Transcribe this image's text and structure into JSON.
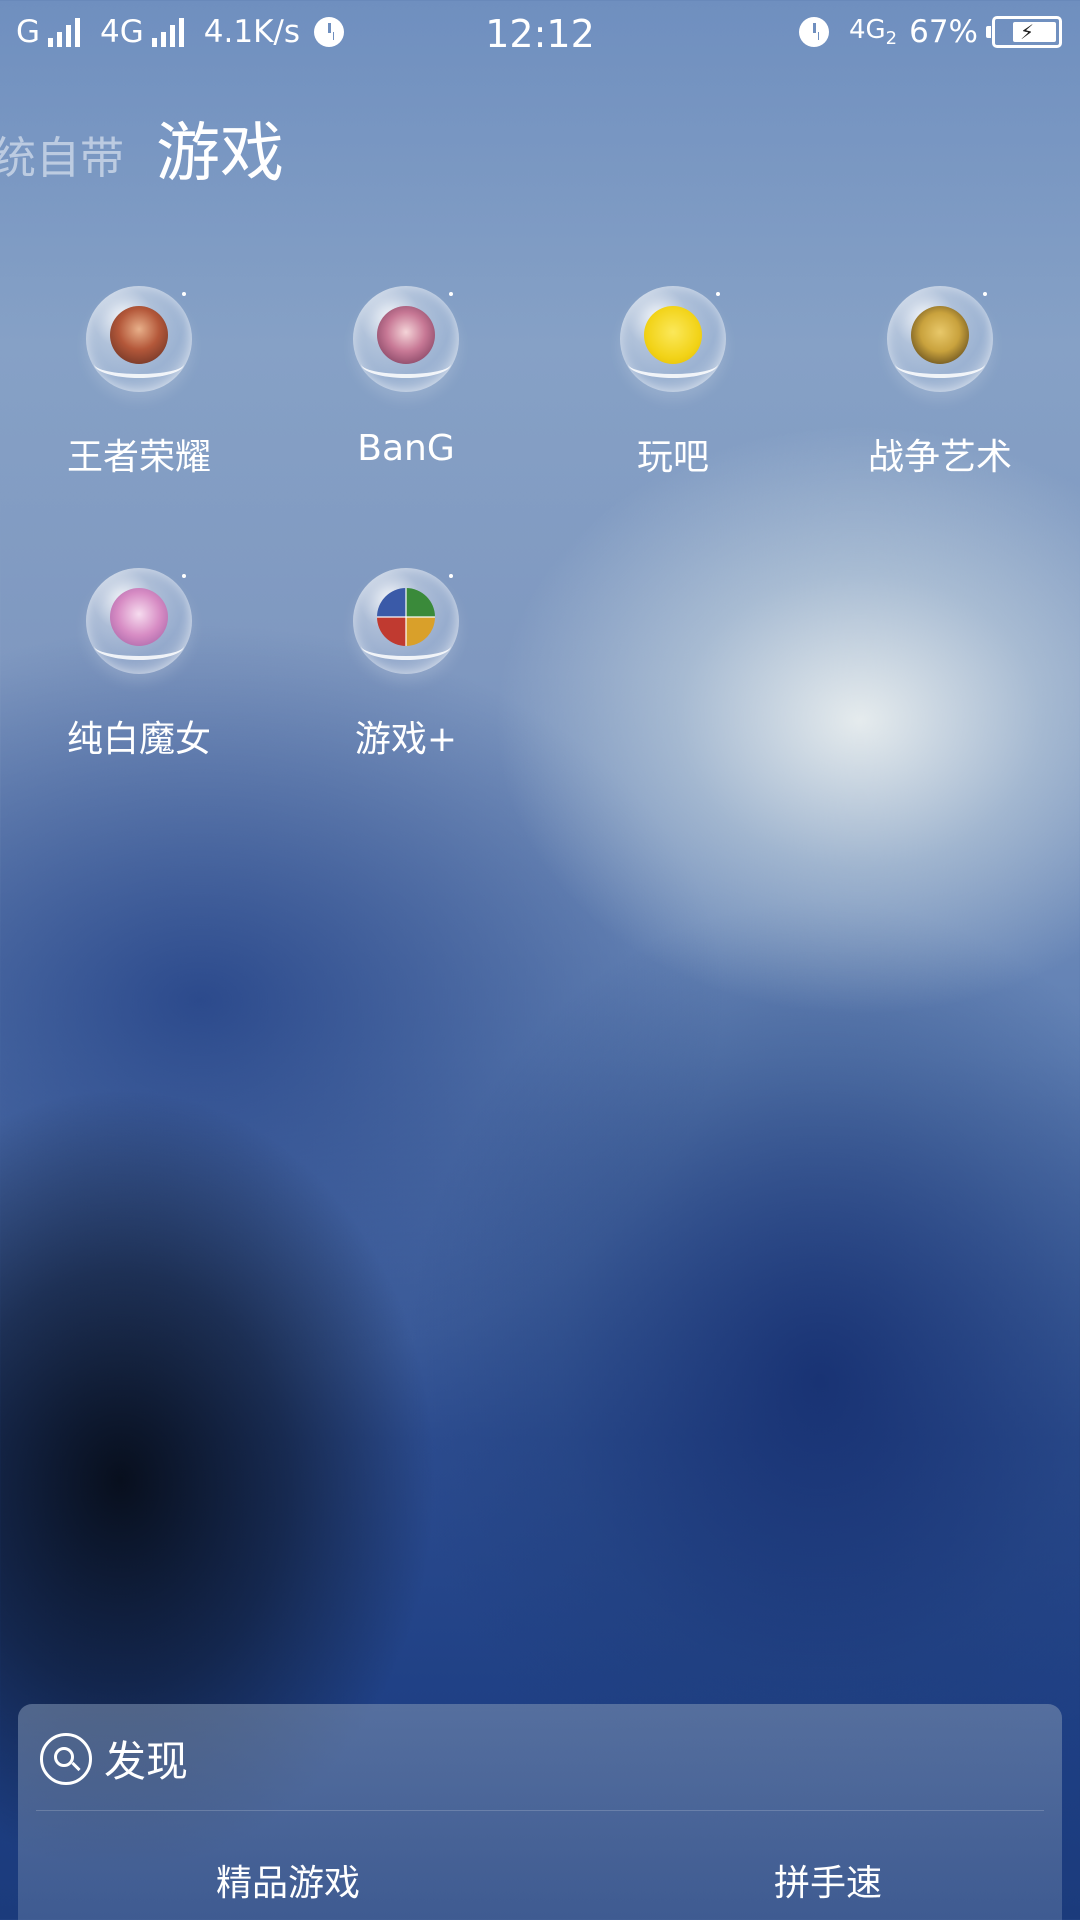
{
  "status_bar": {
    "net1": "G",
    "net2": "4G",
    "speed": "4.1K/s",
    "time": "12:12",
    "net_right": "4G",
    "net_right_sub": "2",
    "battery_percent": "67%",
    "battery_level": 0.67,
    "icons": [
      "signal-icon",
      "alarm-icon",
      "battery-icon"
    ]
  },
  "folder": {
    "prev_tab": "统自带",
    "current_tab": "游戏"
  },
  "apps": [
    {
      "label": "王者荣耀",
      "icon": "honor-of-kings-icon"
    },
    {
      "label": "BanG",
      "icon": "bang-dream-icon"
    },
    {
      "label": "玩吧",
      "icon": "wanba-icon"
    },
    {
      "label": "战争艺术",
      "icon": "art-of-war-icon"
    },
    {
      "label": "纯白魔女",
      "icon": "pure-white-witch-icon"
    },
    {
      "label": "游戏+",
      "icon": "game-plus-icon"
    }
  ],
  "discover": {
    "title": "发现",
    "items": [
      "精品游戏",
      "拼手速"
    ]
  },
  "colors": {
    "wanba_yellow": "#f2d318",
    "art_of_war_gold": "#c9a23d"
  }
}
